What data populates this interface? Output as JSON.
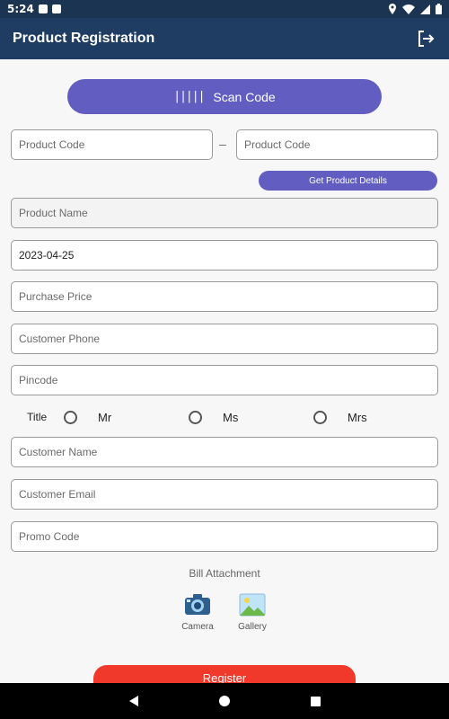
{
  "status_bar": {
    "time": "5:24",
    "icons": [
      "app-icon",
      "sd-card-icon",
      "location-icon",
      "wifi-icon",
      "signal-icon",
      "battery-icon"
    ]
  },
  "app_bar": {
    "title": "Product Registration",
    "logout_icon": "logout-icon"
  },
  "scan": {
    "label": "Scan Code",
    "icon": "barcode-icon",
    "glyph": "|||||"
  },
  "product_code": {
    "placeholder_1": "Product Code",
    "separator": "–",
    "placeholder_2": "Product Code"
  },
  "details_button": {
    "label": "Get Product Details"
  },
  "form": {
    "product_name": "Product Name",
    "date_value": "2023-04-25",
    "purchase_price": "Purchase Price",
    "customer_phone": "Customer Phone",
    "pincode": "Pincode",
    "customer_name": "Customer Name",
    "customer_email": "Customer Email",
    "promo_code": "Promo Code"
  },
  "title_selector": {
    "label": "Title",
    "options": [
      "Mr",
      "Ms",
      "Mrs"
    ]
  },
  "bill": {
    "label": "Bill Attachment",
    "camera": "Camera",
    "gallery": "Gallery"
  },
  "register": {
    "label": "Register"
  },
  "colors": {
    "primary": "#1f3d63",
    "accent": "#625ec1",
    "register": "#f0392b"
  }
}
